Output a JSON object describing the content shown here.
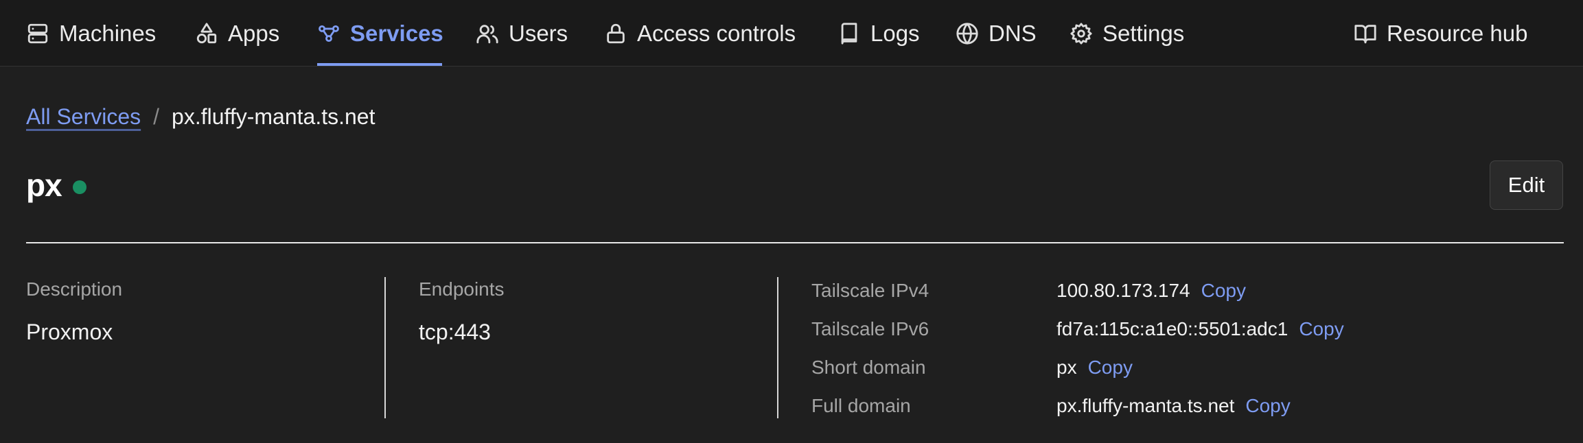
{
  "nav": {
    "items": [
      {
        "label": "Machines",
        "icon": "server-icon"
      },
      {
        "label": "Apps",
        "icon": "shapes-icon"
      },
      {
        "label": "Services",
        "icon": "services-icon",
        "active": true
      },
      {
        "label": "Users",
        "icon": "users-icon"
      },
      {
        "label": "Access controls",
        "icon": "lock-icon"
      },
      {
        "label": "Logs",
        "icon": "book-icon"
      },
      {
        "label": "DNS",
        "icon": "globe-icon"
      },
      {
        "label": "Settings",
        "icon": "gear-icon"
      }
    ],
    "resource_hub": {
      "label": "Resource hub",
      "icon": "open-book-icon"
    }
  },
  "breadcrumb": {
    "parent": "All Services",
    "separator": "/",
    "current": "px.fluffy-manta.ts.net"
  },
  "service": {
    "name": "px",
    "status": "online",
    "edit_label": "Edit"
  },
  "details": {
    "description_label": "Description",
    "description": "Proxmox",
    "endpoints_label": "Endpoints",
    "endpoints": "tcp:443",
    "copy_label": "Copy",
    "rows": [
      {
        "label": "Tailscale IPv4",
        "value": "100.80.173.174"
      },
      {
        "label": "Tailscale IPv6",
        "value": "fd7a:115c:a1e0::5501:adc1"
      },
      {
        "label": "Short domain",
        "value": "px"
      },
      {
        "label": "Full domain",
        "value": "px.fluffy-manta.ts.net"
      }
    ]
  },
  "colors": {
    "background": "#1f1f1f",
    "nav_background": "#1a1a1a",
    "accent": "#7e9cf2",
    "status_online": "#1a8f62"
  }
}
